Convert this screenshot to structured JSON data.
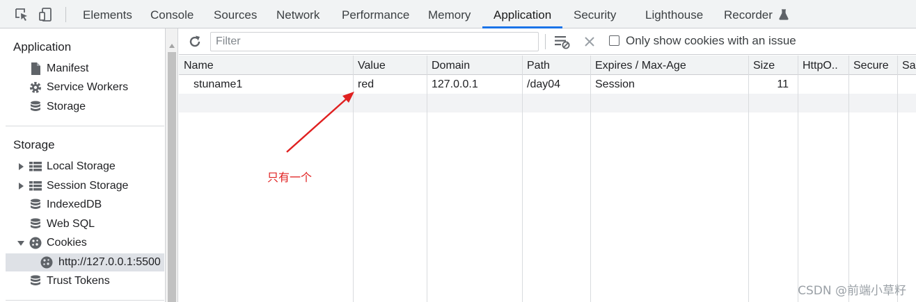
{
  "devtools": {
    "tabs": [
      {
        "label": "Elements"
      },
      {
        "label": "Console"
      },
      {
        "label": "Sources"
      },
      {
        "label": "Network"
      },
      {
        "label": "Performance"
      },
      {
        "label": "Memory"
      },
      {
        "label": "Application",
        "active": true
      },
      {
        "label": "Security"
      },
      {
        "label": "Lighthouse"
      },
      {
        "label": "Recorder"
      }
    ],
    "accent_color": "#1a73e8"
  },
  "sidebar": {
    "application_heading": "Application",
    "application_items": [
      {
        "label": "Manifest",
        "icon": "document-icon"
      },
      {
        "label": "Service Workers",
        "icon": "gear-icon"
      },
      {
        "label": "Storage",
        "icon": "database-icon"
      }
    ],
    "storage_heading": "Storage",
    "storage_items": [
      {
        "label": "Local Storage",
        "icon": "grid-icon",
        "expandable": "collapsed"
      },
      {
        "label": "Session Storage",
        "icon": "grid-icon",
        "expandable": "collapsed"
      },
      {
        "label": "IndexedDB",
        "icon": "database-icon"
      },
      {
        "label": "Web SQL",
        "icon": "database-icon"
      },
      {
        "label": "Cookies",
        "icon": "cookie-icon",
        "expandable": "expanded"
      },
      {
        "label": "http://127.0.0.1:5500",
        "icon": "cookie-icon",
        "selected": true
      },
      {
        "label": "Trust Tokens",
        "icon": "database-icon"
      }
    ]
  },
  "toolbar": {
    "filter_placeholder": "Filter",
    "filter_value": "",
    "only_issue_label": "Only show cookies with an issue",
    "only_issue_checked": false
  },
  "cookies_table": {
    "columns": [
      "Name",
      "Value",
      "Domain",
      "Path",
      "Expires / Max-Age",
      "Size",
      "HttpO..",
      "Secure",
      "Sa"
    ],
    "rows": [
      {
        "name": "stuname1",
        "value": "red",
        "domain": "127.0.0.1",
        "path": "/day04",
        "expires": "Session",
        "size": "11",
        "httponly": "",
        "secure": "",
        "samesite": ""
      }
    ]
  },
  "annotation": {
    "text": "只有一个",
    "color": "#e02020"
  },
  "watermark": "CSDN @前端小草籽"
}
